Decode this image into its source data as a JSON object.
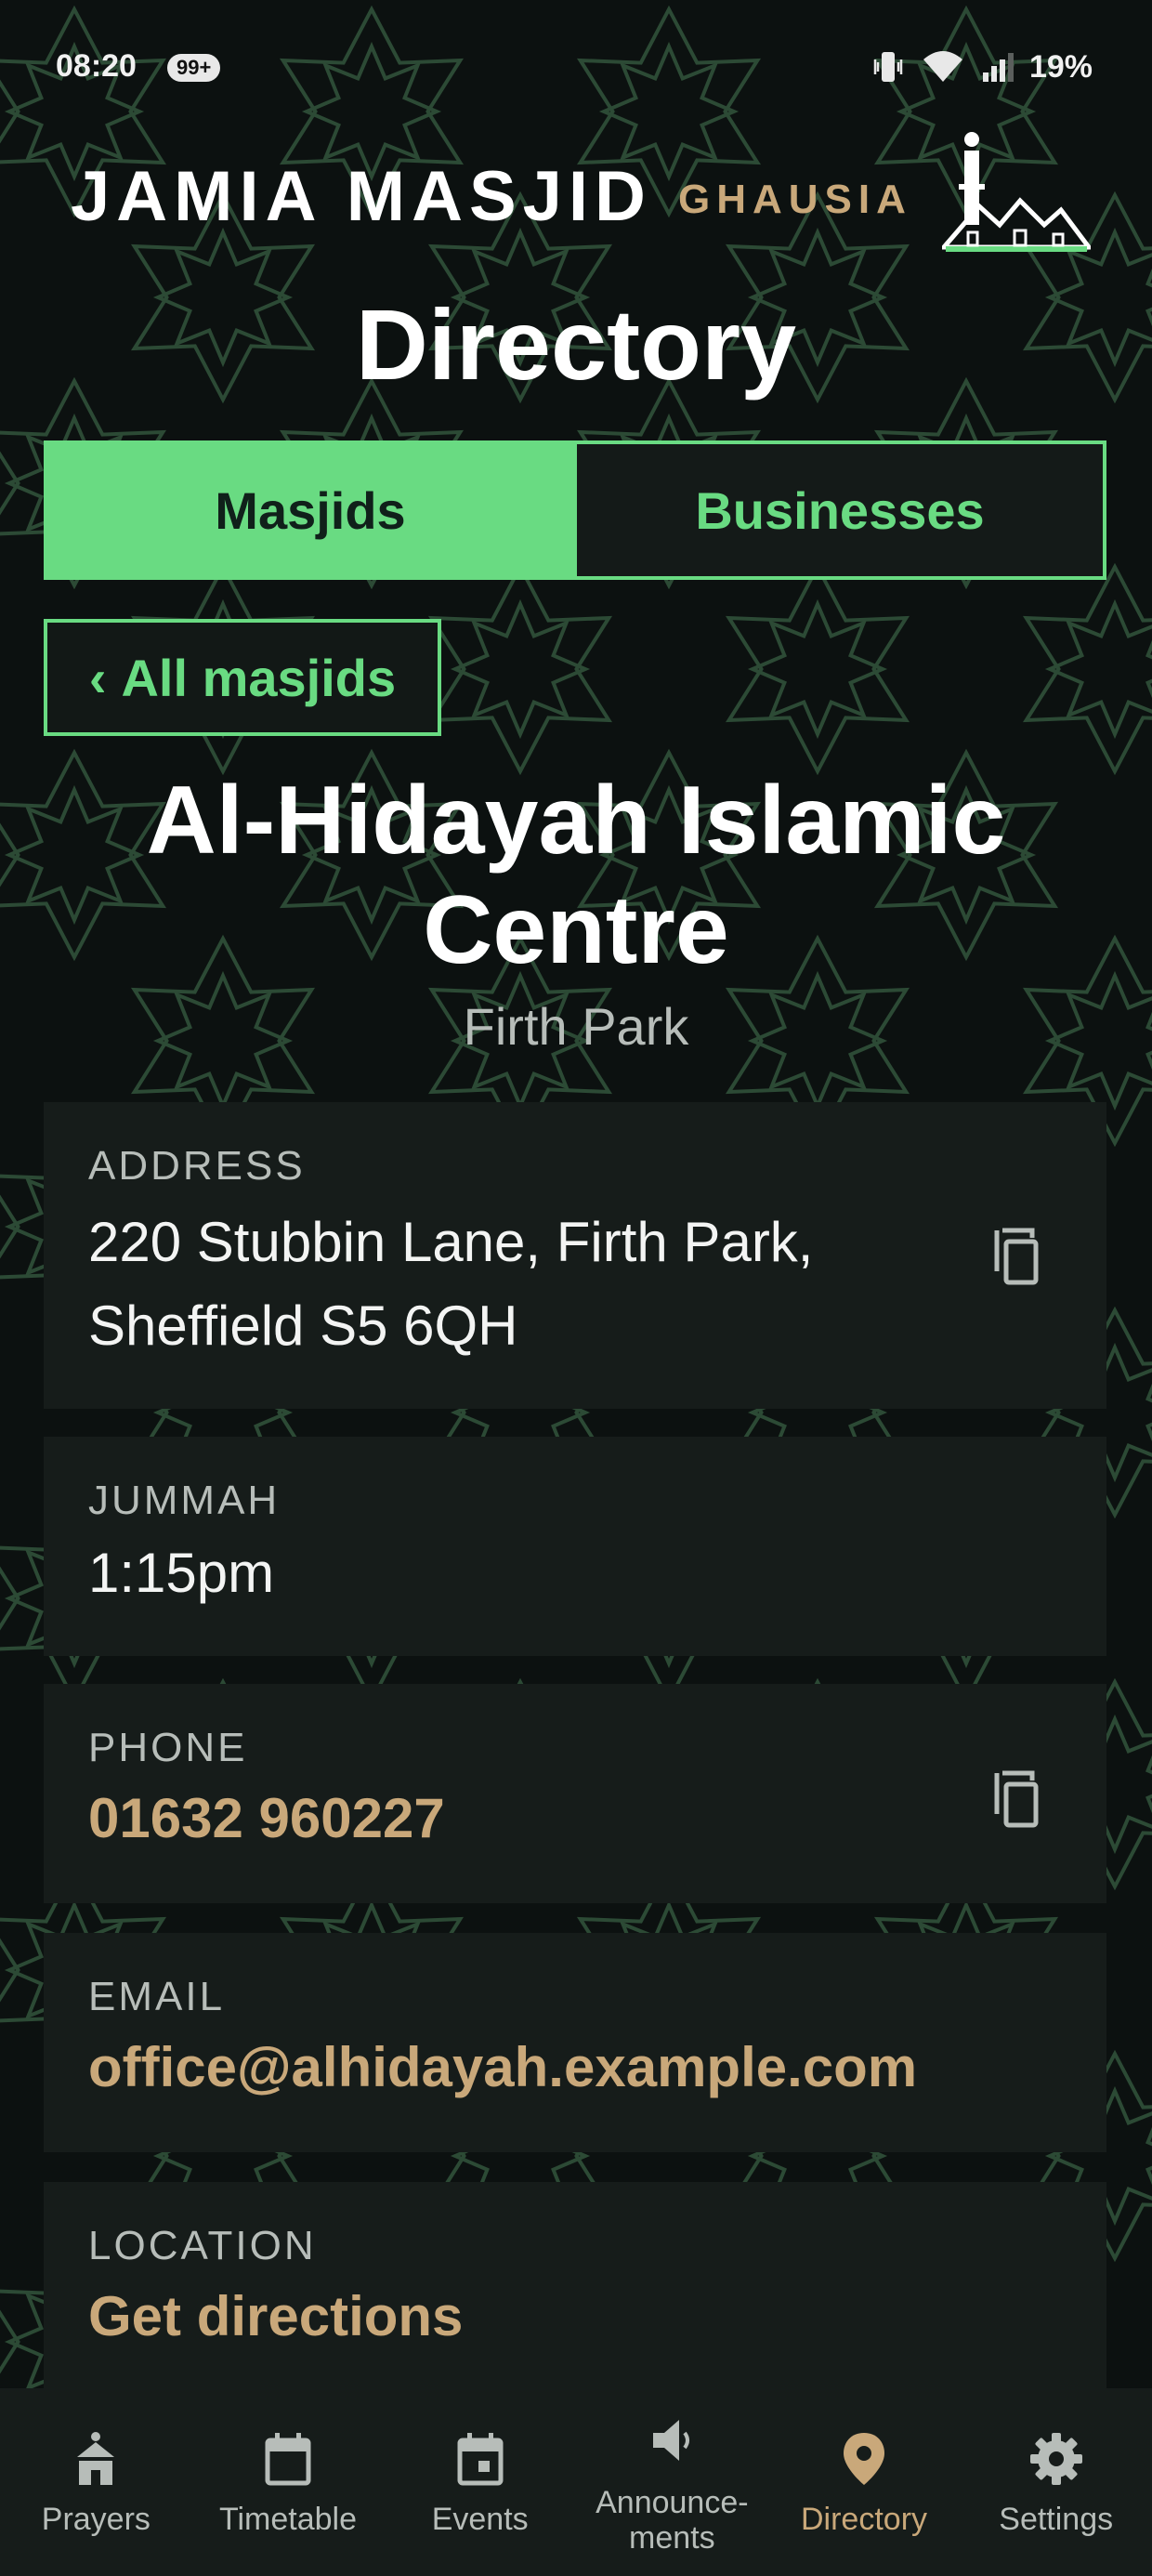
{
  "status_bar": {
    "time": "08:20",
    "notification_badge": "99+",
    "battery": "19%"
  },
  "header": {
    "title_main": "JAMIA MASJID",
    "title_sub": "GHAUSIA"
  },
  "page": {
    "title": "Directory"
  },
  "tabs": [
    {
      "label": "Masjids",
      "active": true
    },
    {
      "label": "Businesses",
      "active": false
    }
  ],
  "back_button": {
    "chevron": "‹",
    "label": "All masjids"
  },
  "masjid": {
    "name": "Al-Hidayah Islamic Centre",
    "area": "Firth Park",
    "address_label": "ADDRESS",
    "address_line1": "220 Stubbin Lane, Firth Park,",
    "address_line2": "Sheffield S5 6QH",
    "jummah_label": "JUMMAH",
    "jummah": "1:15pm",
    "phone_label": "PHONE",
    "phone": "01632 960227",
    "email_label": "EMAIL",
    "email": "office@alhidayah.example.com",
    "location_label": "LOCATION",
    "location_link": "Get directions"
  },
  "nav": [
    {
      "label": "Prayers",
      "icon": "prayer-icon"
    },
    {
      "label": "Timetable",
      "icon": "calendar-icon"
    },
    {
      "label": "Events",
      "icon": "event-icon"
    },
    {
      "label_line1": "Announce-",
      "label_line2": "ments",
      "icon": "megaphone-icon"
    },
    {
      "label": "Directory",
      "icon": "location-pin-icon",
      "active": true
    },
    {
      "label": "Settings",
      "icon": "gear-icon"
    }
  ],
  "colors": {
    "accent_green": "#69db82",
    "gold": "#c9a87a",
    "background": "#0c1110",
    "card": "#161c1a"
  }
}
